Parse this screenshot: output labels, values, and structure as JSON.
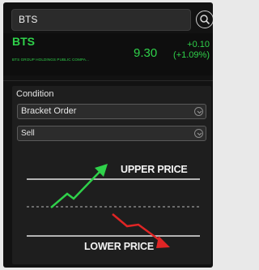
{
  "search": {
    "value": "BTS"
  },
  "quote": {
    "symbol": "BTS",
    "company": "BTS GROUP HOLDINGS PUBLIC COMPA...",
    "price": "9.30",
    "change": "+0.10",
    "change_pct": "(+1.09%)"
  },
  "condition": {
    "label": "Condition",
    "order_type": "Bracket Order",
    "side": "Sell"
  },
  "diagram": {
    "upper_label": "UPPER PRICE",
    "lower_label": "LOWER PRICE"
  },
  "colors": {
    "up": "#2fd14a",
    "down": "#e02525",
    "background": "#121212"
  }
}
